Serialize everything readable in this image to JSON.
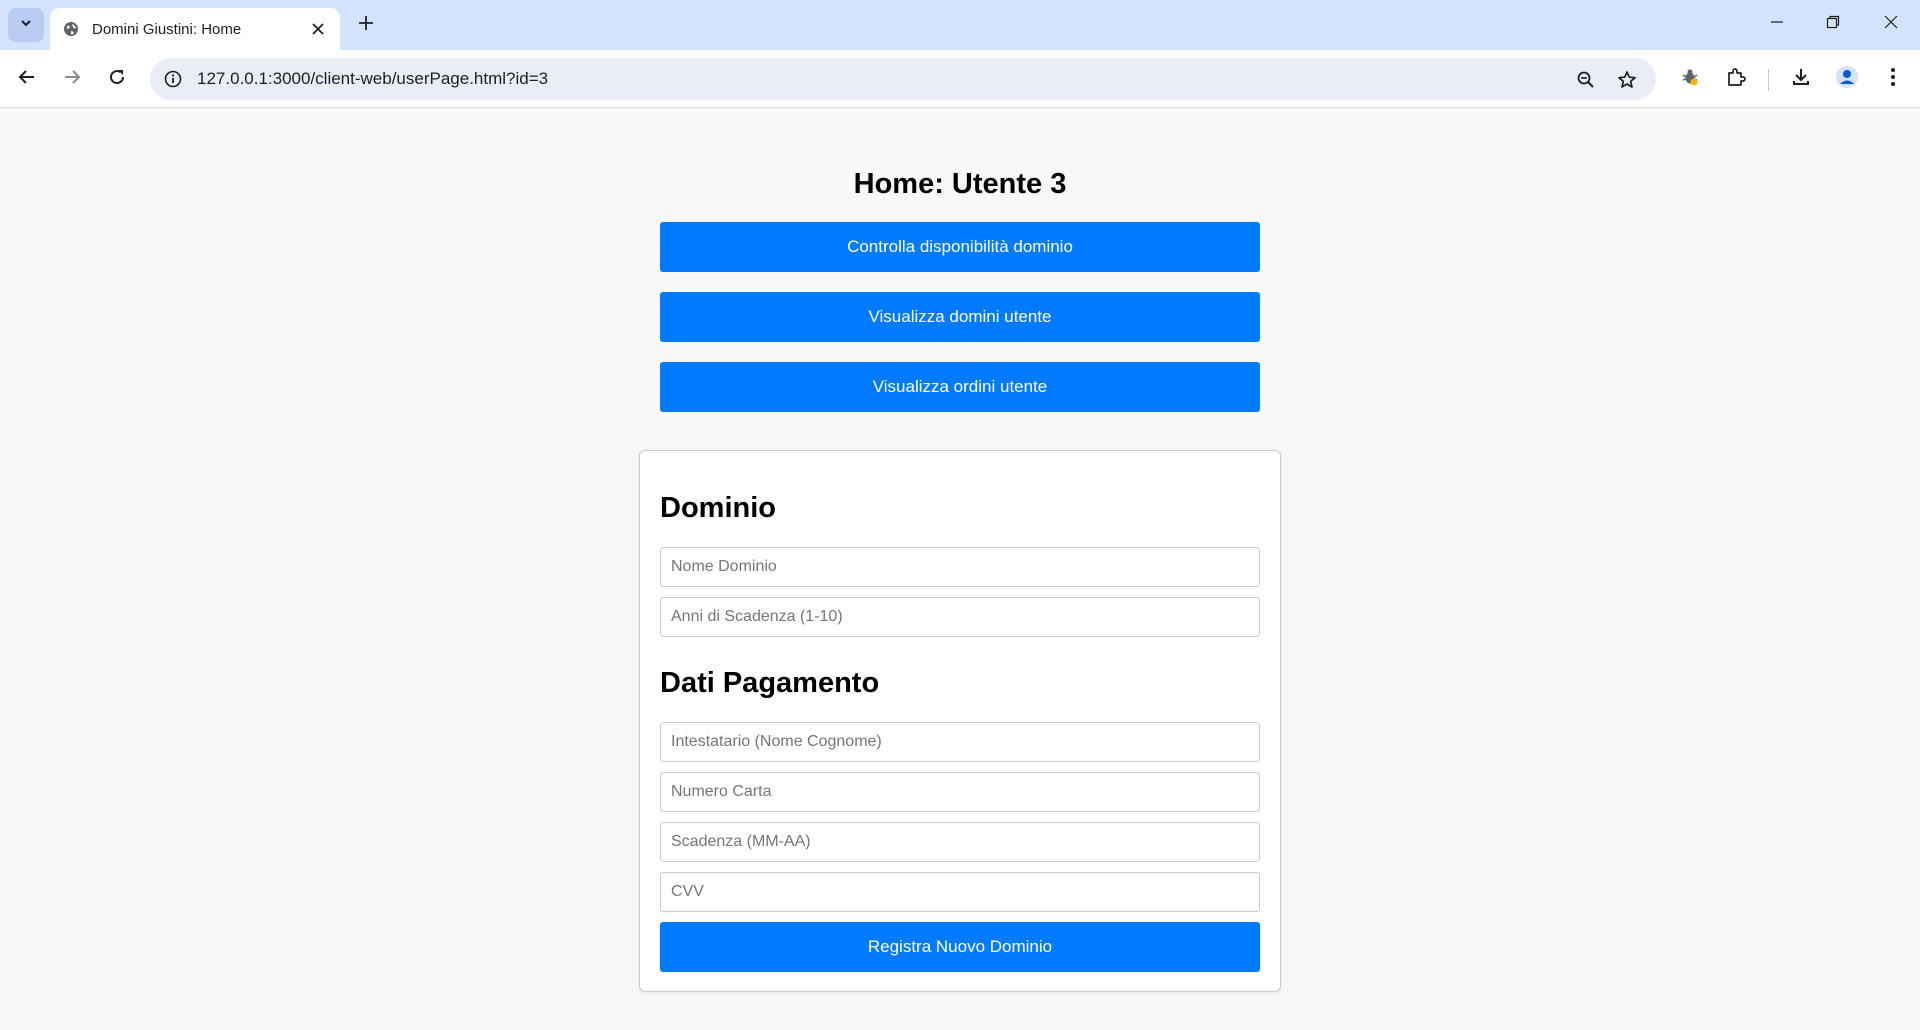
{
  "browser": {
    "tab_title": "Domini Giustini: Home",
    "url": "127.0.0.1:3000/client-web/userPage.html?id=3"
  },
  "page": {
    "title": "Home: Utente 3",
    "buttons": {
      "check_domain": "Controlla disponibilità dominio",
      "view_domains": "Visualizza domini utente",
      "view_orders": "Visualizza ordini utente"
    },
    "form": {
      "domain_section": "Dominio",
      "domain_name_placeholder": "Nome Dominio",
      "years_placeholder": "Anni di Scadenza (1-10)",
      "payment_section": "Dati Pagamento",
      "holder_placeholder": "Intestatario (Nome Cognome)",
      "card_number_placeholder": "Numero Carta",
      "expiry_placeholder": "Scadenza (MM-AA)",
      "cvv_placeholder": "CVV",
      "submit_label": "Registra Nuovo Dominio"
    }
  },
  "colors": {
    "primary": "#007bff",
    "page_bg": "#f8f8f8",
    "tabbar_bg": "#d3e3fd"
  },
  "icons": {
    "tab_search": "chevron-down-icon",
    "favicon": "globe-icon",
    "tab_close": "close-icon",
    "new_tab": "plus-icon",
    "back": "arrow-left-icon",
    "forward": "arrow-right-icon",
    "reload": "reload-icon",
    "site_info": "info-icon",
    "zoom": "zoom-out-icon",
    "bookmark": "star-icon",
    "extension_bug": "bug-icon",
    "extensions": "puzzle-icon",
    "downloads": "download-icon",
    "profile": "profile-icon",
    "menu": "kebab-menu-icon"
  }
}
